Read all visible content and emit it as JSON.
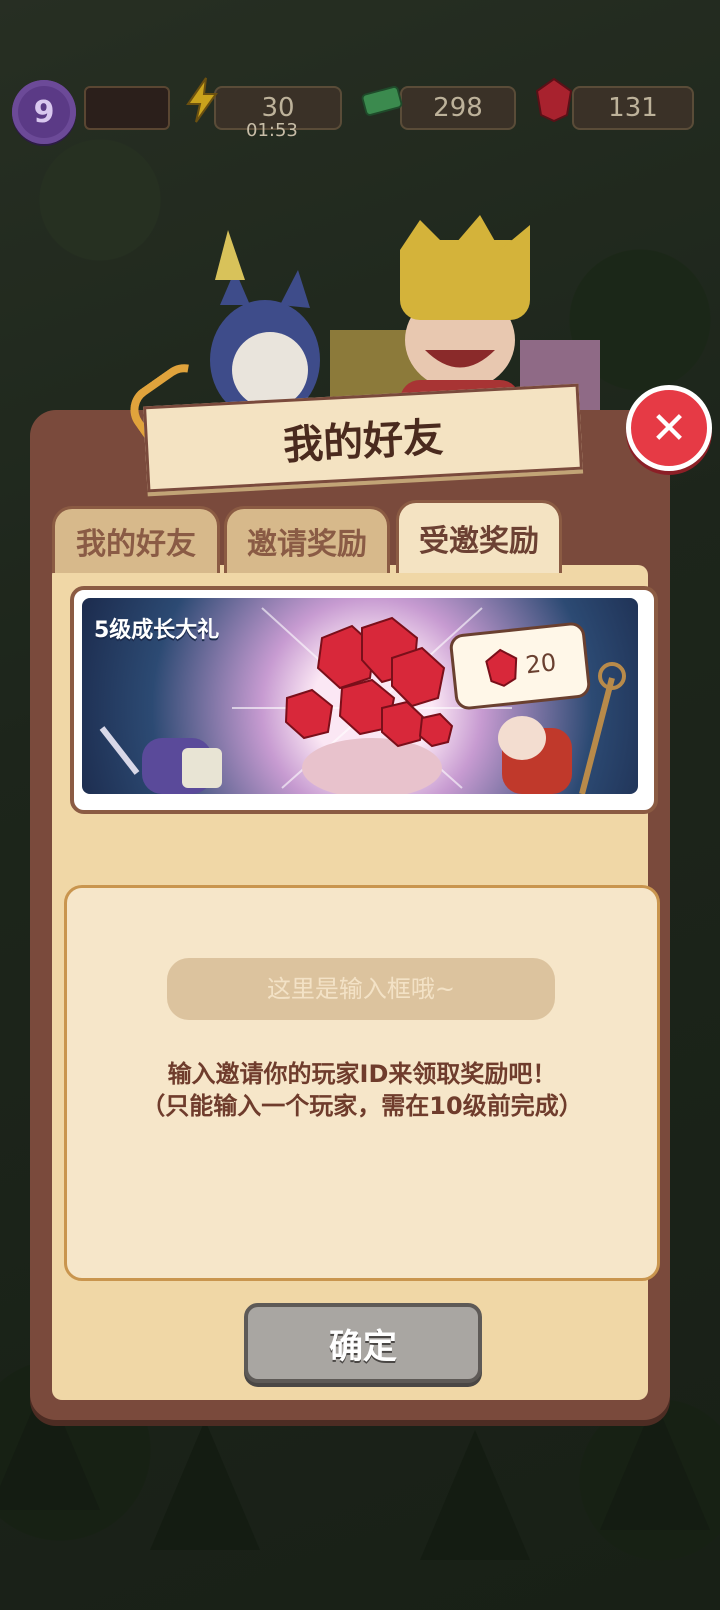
{
  "hud": {
    "level": "9",
    "energy": "30",
    "energy_timer": "01:53",
    "cash": "298",
    "gems": "131"
  },
  "dialog": {
    "title": "我的好友",
    "tabs": [
      {
        "label": "我的好友",
        "active": false
      },
      {
        "label": "邀请奖励",
        "active": false
      },
      {
        "label": "受邀奖励",
        "active": true
      }
    ],
    "reward": {
      "label": "5级成长大礼",
      "gem_amount": "20"
    },
    "input": {
      "placeholder": "这里是输入框哦~"
    },
    "instructions": {
      "line1": "输入邀请你的玩家ID来领取奖励吧！",
      "line2": "（只能输入一个玩家，需在10级前完成）"
    },
    "confirm_label": "确定"
  },
  "colors": {
    "modal_frame": "#7a4a3c",
    "panel": "#f0d7a6",
    "close_red": "#e63a45",
    "gem_red": "#d8283a",
    "confirm_gray": "#a9a6a2"
  }
}
